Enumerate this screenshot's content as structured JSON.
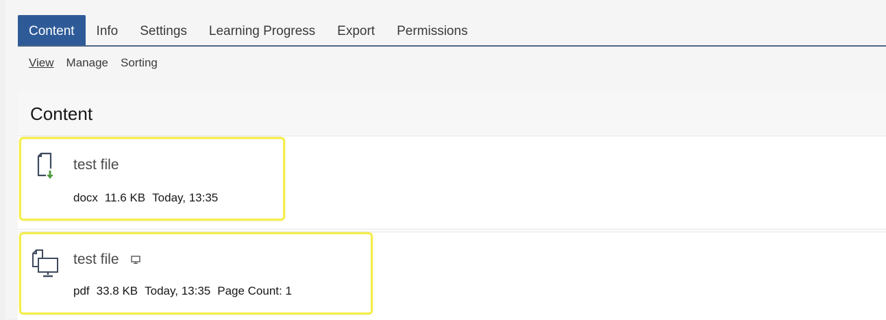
{
  "tabs": [
    {
      "label": "Content",
      "active": true
    },
    {
      "label": "Info"
    },
    {
      "label": "Settings"
    },
    {
      "label": "Learning Progress"
    },
    {
      "label": "Export"
    },
    {
      "label": "Permissions"
    }
  ],
  "subtabs": [
    {
      "label": "View",
      "active": true
    },
    {
      "label": "Manage"
    },
    {
      "label": "Sorting"
    }
  ],
  "panel": {
    "title": "Content"
  },
  "items": [
    {
      "title": "test file",
      "icon": "file-download-icon",
      "type": "docx",
      "size": "11.6 KB",
      "date": "Today, 13:35"
    },
    {
      "title": "test file",
      "icon": "file-presentation-icon",
      "type": "pdf",
      "size": "33.8 KB",
      "date": "Today, 13:35",
      "pages": "Page Count: 1",
      "badge_icon": "monitor-icon"
    }
  ],
  "colors": {
    "accent": "#2e5b98",
    "highlight": "#f5ee4a",
    "download": "#4f9a3f"
  }
}
